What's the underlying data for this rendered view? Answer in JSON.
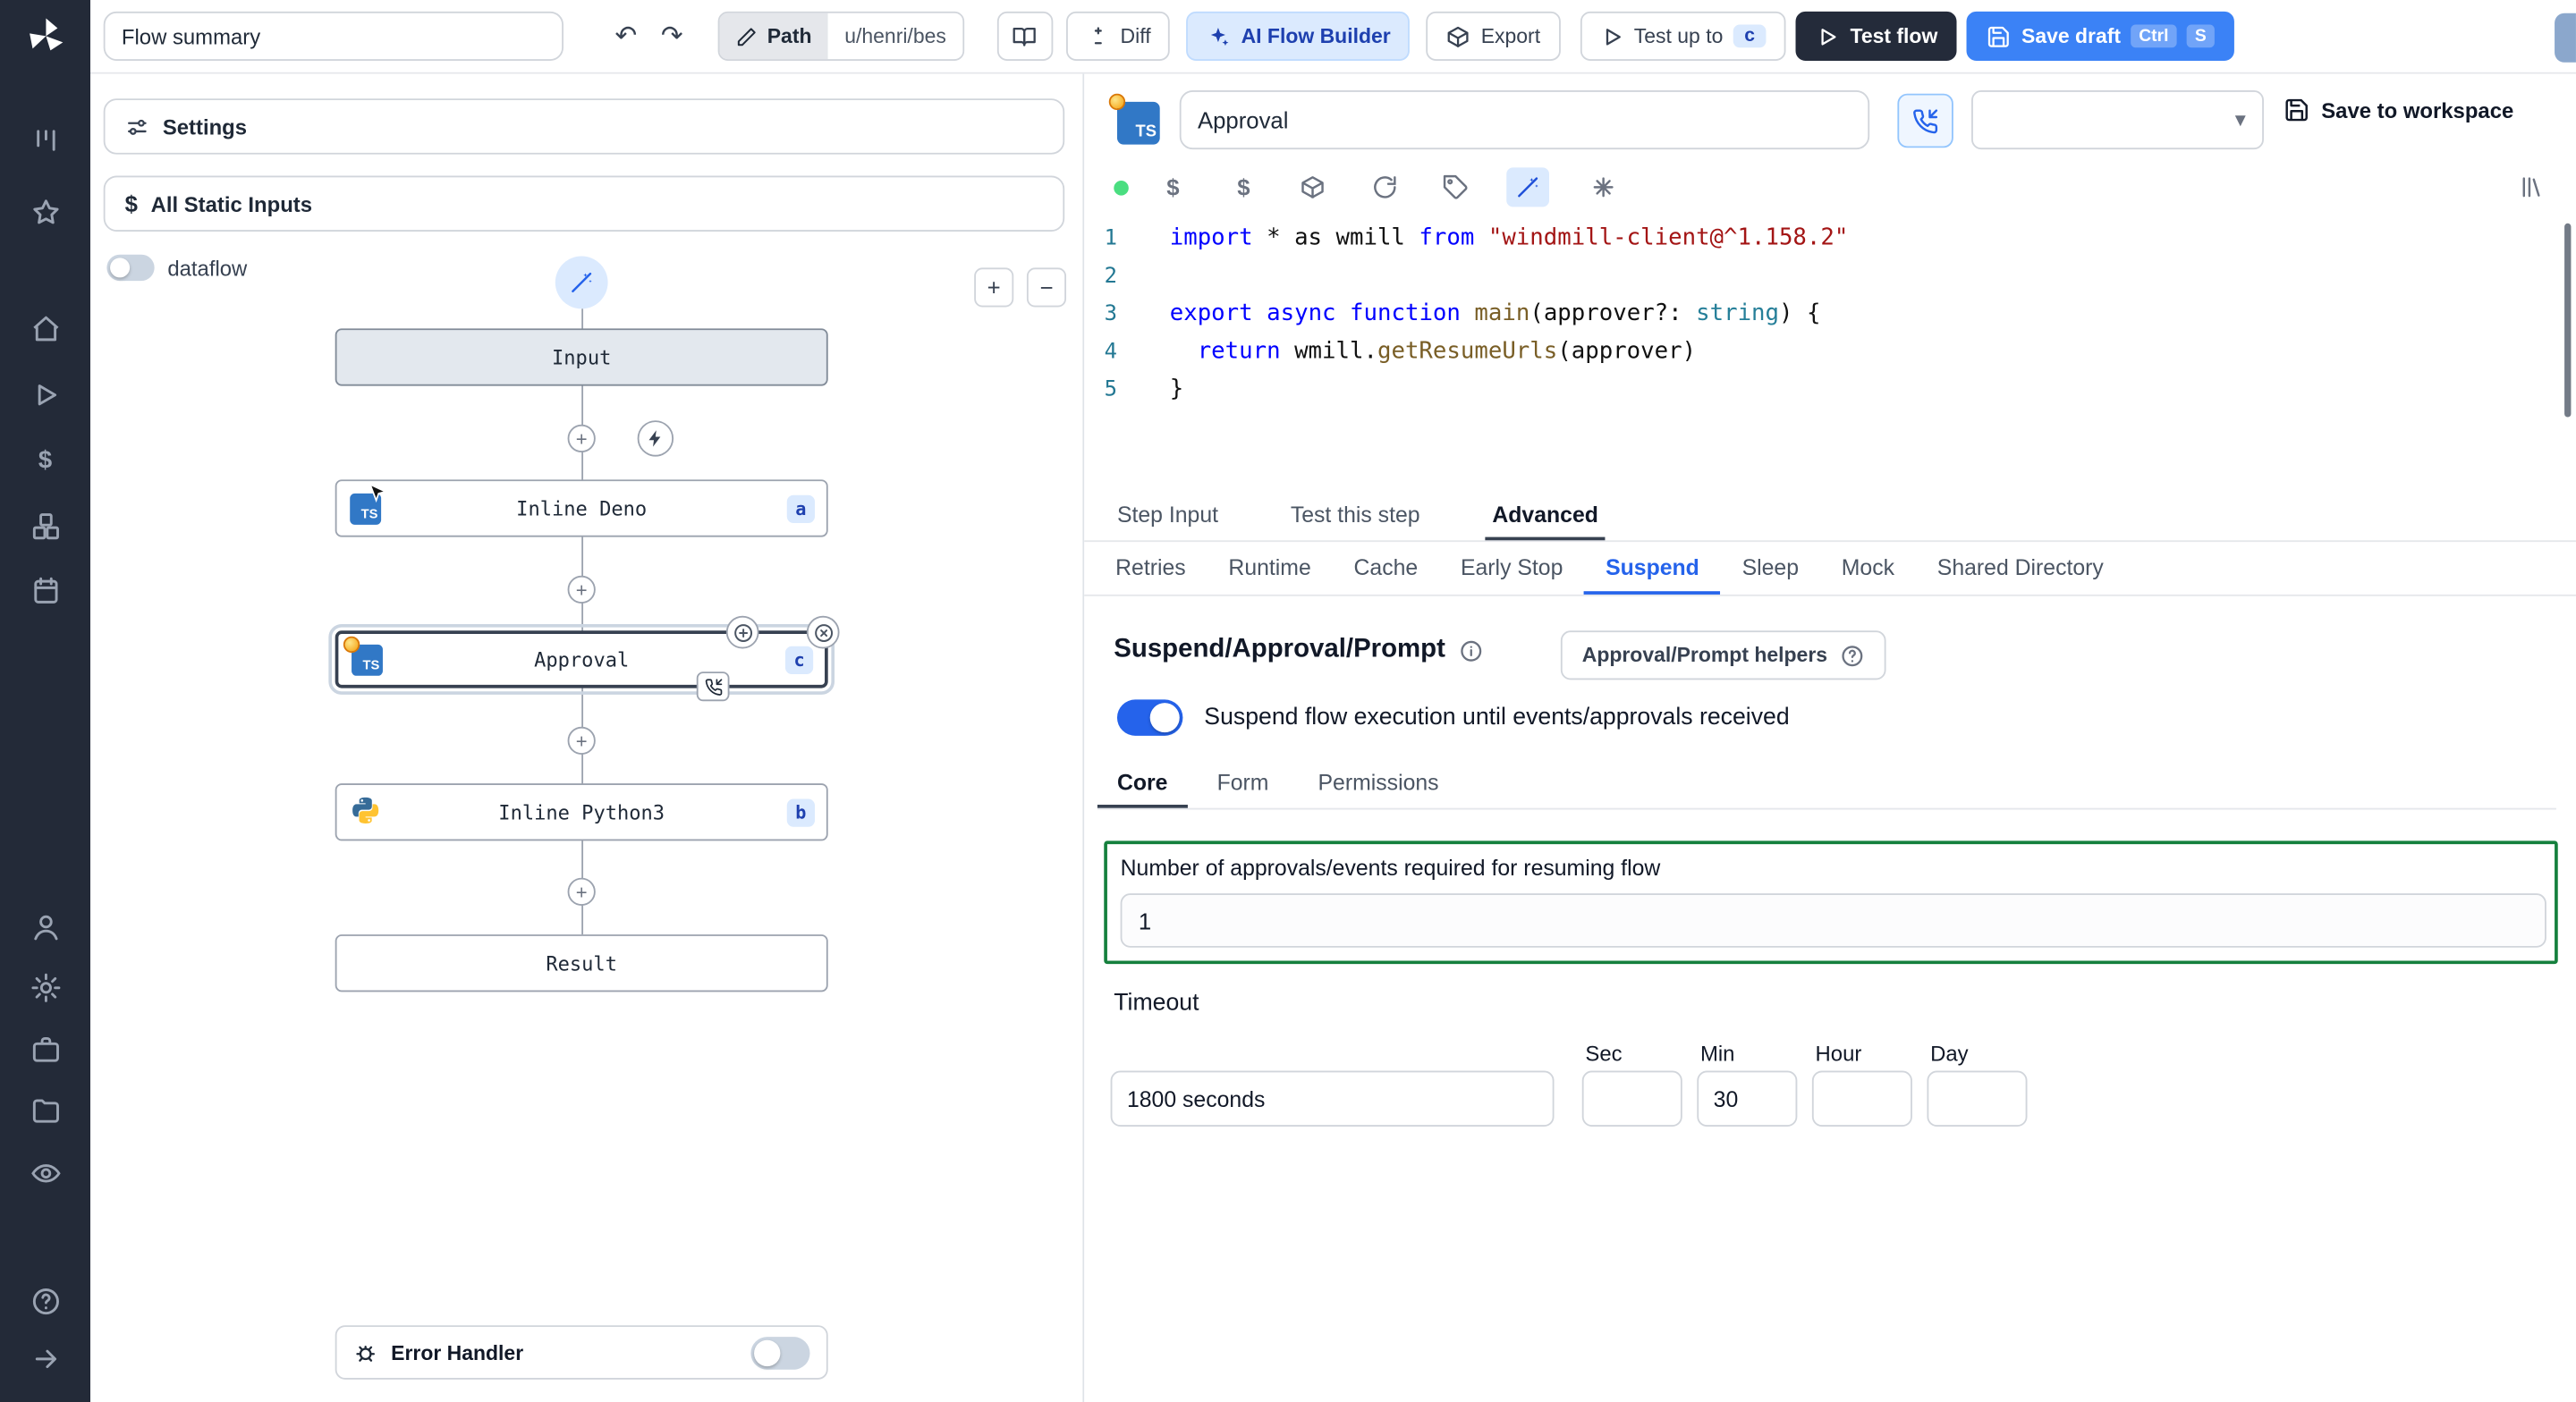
{
  "colors": {
    "accent_blue": "#3b82f6",
    "ai_button_bg": "#dbeafe",
    "dark_button": "#242b3a",
    "sidebar_bg": "#232a38",
    "suspend_box_border": "#15803d",
    "ts_logo_blue": "#3178c6",
    "toggle_on_blue": "#2563eb",
    "run_status_green": "#4ade80"
  },
  "glyphs": {
    "undo": "↶",
    "redo": "↷",
    "plus": "+",
    "minus": "−",
    "chevron_down": "▾",
    "dollar": "$"
  },
  "sidebar": {
    "icon_names": [
      "windmill-logo",
      "kanban-icon",
      "star-icon",
      "home-icon",
      "runs-play-icon",
      "variables-dollar-icon",
      "resources-boxes-icon",
      "schedules-calendar-icon",
      "user-icon",
      "settings-gear-icon",
      "workers-briefcase-icon",
      "folders-icon",
      "audit-eye-icon",
      "help-icon",
      "expand-arrow-icon"
    ]
  },
  "topbar": {
    "flow_summary": "Flow summary",
    "path_label": "Path",
    "path_value": "u/henri/bes",
    "diff_label": "Diff",
    "ai_builder_label": "AI Flow Builder",
    "export_label": "Export",
    "test_up_to_label": "Test up to",
    "test_up_to_badge": "c",
    "test_flow_label": "Test flow",
    "save_draft_label": "Save draft",
    "save_draft_kbd_1": "Ctrl",
    "save_draft_kbd_2": "S"
  },
  "flow_panel": {
    "settings_label": "Settings",
    "static_inputs_label": "All Static Inputs",
    "dataflow_label": "dataflow",
    "error_handler_label": "Error Handler",
    "nodes": [
      {
        "label": "Input"
      },
      {
        "label": "Inline Deno",
        "badge": "a"
      },
      {
        "label": "Approval",
        "badge": "c"
      },
      {
        "label": "Inline Python3",
        "badge": "b"
      },
      {
        "label": "Result"
      }
    ]
  },
  "editor_panel": {
    "step_name": "Approval",
    "save_to_workspace_label": "Save to workspace",
    "code": {
      "lines": [
        [
          {
            "t": "kw",
            "v": "import"
          },
          {
            "t": "pl",
            "v": " * as wmill "
          },
          {
            "t": "kw",
            "v": "from"
          },
          {
            "t": "pl",
            "v": " "
          },
          {
            "t": "str",
            "v": "\"windmill-client@^1.158.2\""
          }
        ],
        [],
        [
          {
            "t": "kw",
            "v": "export"
          },
          {
            "t": "pl",
            "v": " "
          },
          {
            "t": "kw",
            "v": "async"
          },
          {
            "t": "pl",
            "v": " "
          },
          {
            "t": "kw",
            "v": "function"
          },
          {
            "t": "pl",
            "v": " "
          },
          {
            "t": "fn",
            "v": "main"
          },
          {
            "t": "pl",
            "v": "(approver?: "
          },
          {
            "t": "type",
            "v": "string"
          },
          {
            "t": "pl",
            "v": ") {"
          }
        ],
        [
          {
            "t": "pl",
            "v": "  "
          },
          {
            "t": "kw",
            "v": "return"
          },
          {
            "t": "pl",
            "v": " wmill."
          },
          {
            "t": "fn",
            "v": "getResumeUrls"
          },
          {
            "t": "pl",
            "v": "(approver)"
          }
        ],
        [
          {
            "t": "pl",
            "v": "}"
          }
        ]
      ]
    },
    "tabs": [
      "Step Input",
      "Test this step",
      "Advanced"
    ],
    "tabs_selected": "Advanced",
    "advanced_tabs": [
      "Retries",
      "Runtime",
      "Cache",
      "Early Stop",
      "Suspend",
      "Sleep",
      "Mock",
      "Shared Directory"
    ],
    "advanced_selected": "Suspend",
    "suspend": {
      "title": "Suspend/Approval/Prompt",
      "helpers_label": "Approval/Prompt helpers",
      "toggle_label": "Suspend flow execution until events/approvals received",
      "sub_tabs": [
        "Core",
        "Form",
        "Permissions"
      ],
      "sub_selected": "Core",
      "approvals_label": "Number of approvals/events required for resuming flow",
      "approvals_value": "1",
      "timeout_label": "Timeout",
      "timeout_value": "1800 seconds",
      "timeout_units": [
        "Sec",
        "Min",
        "Hour",
        "Day"
      ],
      "timeout_min_value": "30"
    }
  }
}
